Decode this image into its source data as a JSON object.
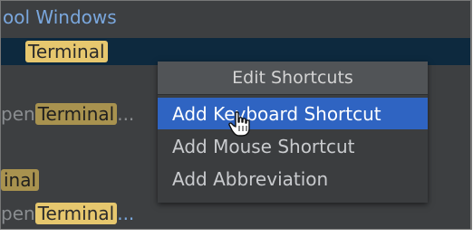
{
  "tree": {
    "section_label": "ool Windows",
    "rows": [
      {
        "highlight": "Terminal"
      },
      {
        "prefix": "pen ",
        "highlight": "Terminal",
        "suffix": "..."
      },
      {
        "highlight": "inal"
      },
      {
        "prefix": "pen ",
        "highlight": "Terminal",
        "suffix": "..."
      }
    ]
  },
  "context_menu": {
    "header": "Edit Shortcuts",
    "items": [
      {
        "label": "Add Keyboard Shortcut"
      },
      {
        "label": "Add Mouse Shortcut"
      },
      {
        "label": "Add Abbreviation"
      }
    ]
  },
  "colors": {
    "background": "#3d3f41",
    "selection_row": "#0d293e",
    "menu_highlight": "#2f64c2",
    "match_highlight": "#e6c76e",
    "link_blue": "#7aa7dd"
  },
  "icons": {
    "cursor": "hand-pointer-icon"
  }
}
